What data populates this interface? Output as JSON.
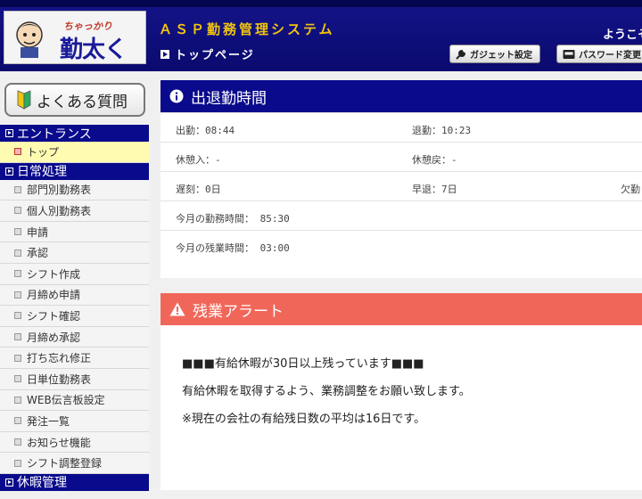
{
  "header": {
    "logo_small": "ちゃっかり",
    "logo_big": "勤太くん",
    "system_title": "ＡＳＰ勤務管理システム",
    "user_greeting": "ようこそ",
    "page_crumb": "トップページ",
    "gadget_button": "ガジェット設定",
    "password_button": "パスワード変更"
  },
  "sidebar": {
    "faq_button": "よくある質問",
    "sections": [
      {
        "title": "エントランス",
        "items": [
          "トップ"
        ]
      },
      {
        "title": "日常処理",
        "items": [
          "部門別勤務表",
          "個人別勤務表",
          "申請",
          "承認",
          "シフト作成",
          "月締め申請",
          "シフト確認",
          "月締め承認",
          "打ち忘れ修正",
          "日単位勤務表",
          "WEB伝言板設定",
          "発注一覧",
          "お知らせ機能",
          "シフト調整登録"
        ]
      },
      {
        "title": "休暇管理",
        "items": []
      }
    ],
    "active_item": "トップ"
  },
  "attendance": {
    "title": "出退勤時間",
    "clock_in": "出勤：08:44",
    "clock_out": "退勤：10:23",
    "break_in": "休憩入：-",
    "break_out": "休憩戻：-",
    "late": "遅刻：0日",
    "early_leave": "早退：7日",
    "absence": "欠勤",
    "month_work": "今月の勤務時間： 85:30",
    "month_overtime": "今月の残業時間： 03:00"
  },
  "alert": {
    "title": "残業アラート",
    "line1": "■■■有給休暇が30日以上残っています■■■",
    "line2": "有給休暇を取得するよう、業務調整をお願い致します。",
    "line3": "※現在の会社の有給残日数の平均は16日です。"
  },
  "colors": {
    "header_navy": "#0a0a6e",
    "section_blue": "#0a0a8c",
    "alert_red": "#f0675a",
    "title_gold": "#f1c40f",
    "active_yellow": "#fffbb0"
  }
}
